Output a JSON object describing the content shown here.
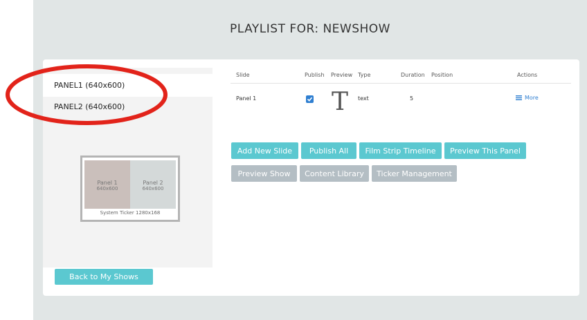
{
  "page": {
    "title": "PLAYLIST FOR: NEWSHOW"
  },
  "panels": [
    {
      "label": "PANEL1  (640x600)"
    },
    {
      "label": "PANEL2  (640x600)"
    }
  ],
  "layout": {
    "panel1_name": "Panel 1",
    "panel1_size": "640x600",
    "panel2_name": "Panel 2",
    "panel2_size": "640x600",
    "ticker": "System Ticker 1280x168"
  },
  "back_button": "Back to My Shows",
  "table": {
    "headers": [
      "Slide",
      "Publish",
      "Preview",
      "Type",
      "Duration",
      "Position",
      "Actions"
    ],
    "rows": [
      {
        "slide": "Panel 1",
        "publish": true,
        "preview": "T",
        "type": "text",
        "duration": "5",
        "position": "",
        "action": "More"
      }
    ]
  },
  "buttons_row1": [
    "Add New Slide",
    "Publish All",
    "Film Strip Timeline",
    "Preview This Panel"
  ],
  "buttons_row2": [
    "Preview Show",
    "Content Library",
    "Ticker Management"
  ],
  "colors": {
    "teal": "#5bc8d0",
    "grey": "#b4bec4",
    "annotation": "#e2231a",
    "link": "#2f7fd1"
  },
  "icons": {
    "more": "menu-lines-icon",
    "publish": "checkbox-checked-icon"
  }
}
